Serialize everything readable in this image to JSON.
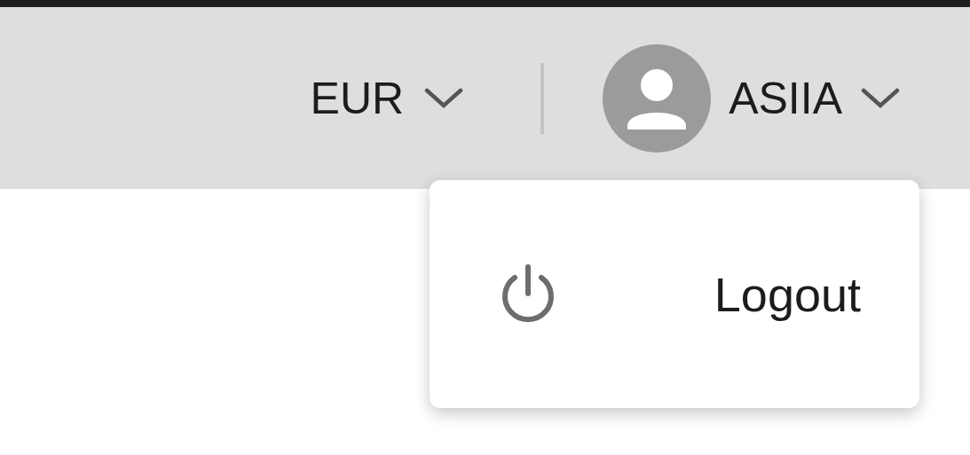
{
  "currency": {
    "label": "EUR"
  },
  "user": {
    "name": "ASIIA",
    "expanded": true
  },
  "menu": {
    "items": [
      {
        "kind": "logout",
        "label": "Logout"
      }
    ]
  }
}
